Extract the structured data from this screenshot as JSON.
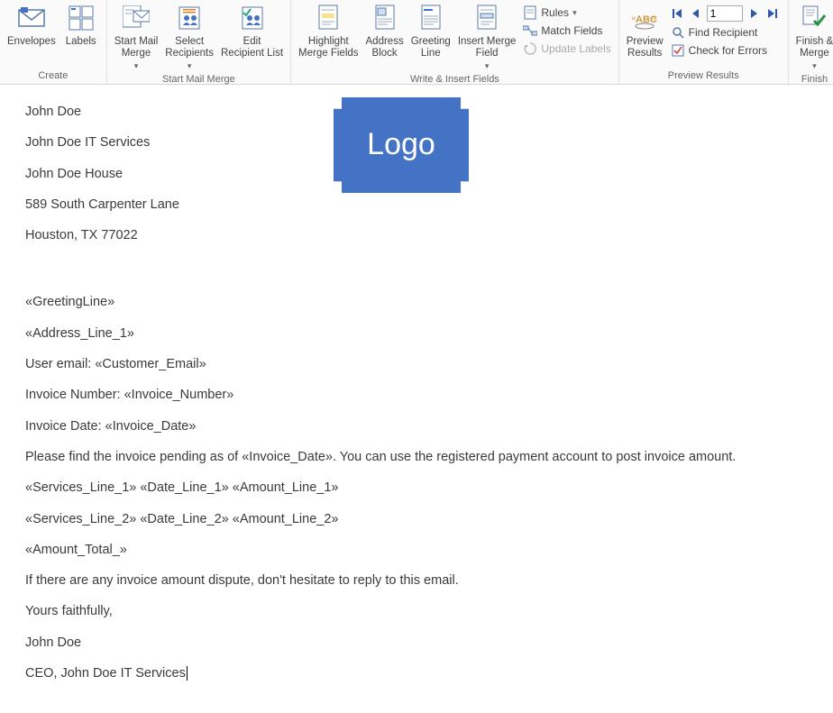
{
  "ribbon": {
    "groups": {
      "create": {
        "label": "Create",
        "envelopes": "Envelopes",
        "labels": "Labels"
      },
      "start": {
        "label": "Start Mail Merge",
        "start_mail_merge": "Start Mail\nMerge",
        "select_recipients": "Select\nRecipients",
        "edit_recipient_list": "Edit\nRecipient List"
      },
      "write": {
        "label": "Write & Insert Fields",
        "highlight_merge_fields": "Highlight\nMerge Fields",
        "address_block": "Address\nBlock",
        "greeting_line": "Greeting\nLine",
        "insert_merge_field": "Insert Merge\nField",
        "rules": "Rules",
        "match_fields": "Match Fields",
        "update_labels": "Update Labels"
      },
      "preview": {
        "label": "Preview Results",
        "preview_results": "Preview\nResults",
        "record_value": "1",
        "find_recipient": "Find Recipient",
        "check_for_errors": "Check for Errors"
      },
      "finish": {
        "label": "Finish",
        "finish_merge": "Finish &\nMerge"
      }
    }
  },
  "doc": {
    "sender_name": "John Doe",
    "sender_company": "John Doe IT Services",
    "sender_building": "John Doe House",
    "sender_street": "589 South Carpenter Lane",
    "sender_city_state_zip": "Houston, TX 77022",
    "greeting_field": "«GreetingLine»",
    "address_field": "«Address_Line_1»",
    "email_line": "User email: «Customer_Email»",
    "invoice_number_line": "Invoice Number: «Invoice_Number»",
    "invoice_date_line": "Invoice Date: «Invoice_Date»",
    "body1": "Please find the invoice pending as of «Invoice_Date». You can use the registered payment account to post invoice amount.",
    "services1": "«Services_Line_1» «Date_Line_1» «Amount_Line_1»",
    "services2": "«Services_Line_2» «Date_Line_2» «Amount_Line_2»",
    "total": "«Amount_Total_»",
    "body2": "If there are any invoice amount dispute, don't hesitate to reply to this email.",
    "signoff": "Yours faithfully,",
    "sig_name": "John Doe",
    "sig_title": "CEO, John Doe IT Services",
    "logo_text": "Logo"
  }
}
